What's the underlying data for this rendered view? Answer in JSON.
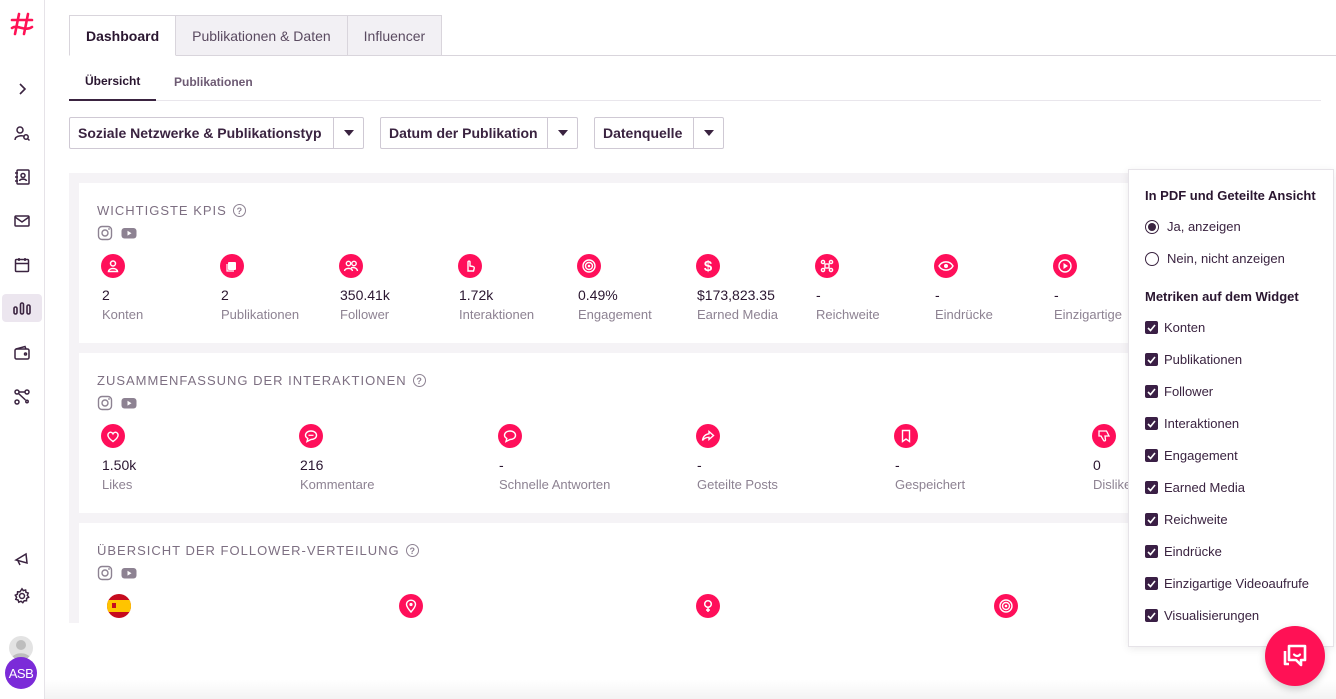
{
  "nav": {
    "tabs": [
      {
        "label": "Dashboard"
      },
      {
        "label": "Publikationen & Daten"
      },
      {
        "label": "Influencer"
      }
    ],
    "subtabs": [
      {
        "label": "Übersicht"
      },
      {
        "label": "Publikationen"
      }
    ]
  },
  "filters": [
    {
      "label": "Soziale Netzwerke & Publikationstyp"
    },
    {
      "label": "Datum der Publikation"
    },
    {
      "label": "Datenquelle"
    }
  ],
  "sidebar": {
    "avatar_initials": "ASB",
    "icons": [
      "chevron-right-icon",
      "user-search-icon",
      "contacts-icon",
      "mail-icon",
      "calendar-icon",
      "analytics-icon",
      "wallet-icon",
      "workflow-icon",
      "megaphone-icon",
      "settings-icon"
    ]
  },
  "kpis": {
    "title": "WICHTIGSTE KPIS",
    "metrics": [
      {
        "value": "2",
        "label": "Konten",
        "icon": "user-icon"
      },
      {
        "value": "2",
        "label": "Publikationen",
        "icon": "square-icon"
      },
      {
        "value": "350.41k",
        "label": "Follower",
        "icon": "users-icon"
      },
      {
        "value": "1.72k",
        "label": "Interaktionen",
        "icon": "hand-pointer-icon"
      },
      {
        "value": "0.49%",
        "label": "Engagement",
        "icon": "target-icon"
      },
      {
        "value": "$173,823.35",
        "label": "Earned Media",
        "icon": "dollar-icon"
      },
      {
        "value": "-",
        "label": "Reichweite",
        "icon": "network-icon"
      },
      {
        "value": "-",
        "label": "Eindrücke",
        "icon": "eye-icon"
      },
      {
        "value": "-",
        "label": "Einzigartige",
        "icon": "play-icon"
      }
    ]
  },
  "interactions": {
    "title": "ZUSAMMENFASSUNG DER INTERAKTIONEN",
    "metrics": [
      {
        "value": "1.50k",
        "label": "Likes",
        "icon": "heart-icon"
      },
      {
        "value": "216",
        "label": "Kommentare",
        "icon": "comment-icon"
      },
      {
        "value": "-",
        "label": "Schnelle Antworten",
        "icon": "quick-reply-icon"
      },
      {
        "value": "-",
        "label": "Geteilte Posts",
        "icon": "share-icon"
      },
      {
        "value": "-",
        "label": "Gespeichert",
        "icon": "bookmark-icon"
      },
      {
        "value": "0",
        "label": "Dislike",
        "icon": "thumbs-down-icon"
      }
    ]
  },
  "followers": {
    "title": "ÜBERSICHT DER FOLLOWER-VERTEILUNG"
  },
  "panel": {
    "share_heading": "In PDF und Geteilte Ansicht",
    "radio_yes": "Ja, anzeigen",
    "radio_no": "Nein, nicht anzeigen",
    "metrics_heading": "Metriken auf dem Widget",
    "checks": [
      {
        "label": "Konten"
      },
      {
        "label": "Publikationen"
      },
      {
        "label": "Follower"
      },
      {
        "label": "Interaktionen"
      },
      {
        "label": "Engagement"
      },
      {
        "label": "Earned Media"
      },
      {
        "label": "Reichweite"
      },
      {
        "label": "Eindrücke"
      },
      {
        "label": "Einzigartige Videoaufrufe"
      },
      {
        "label": "Visualisierungen"
      }
    ]
  },
  "colors": {
    "accent": "#ff0f5a",
    "dark": "#3a2340"
  }
}
